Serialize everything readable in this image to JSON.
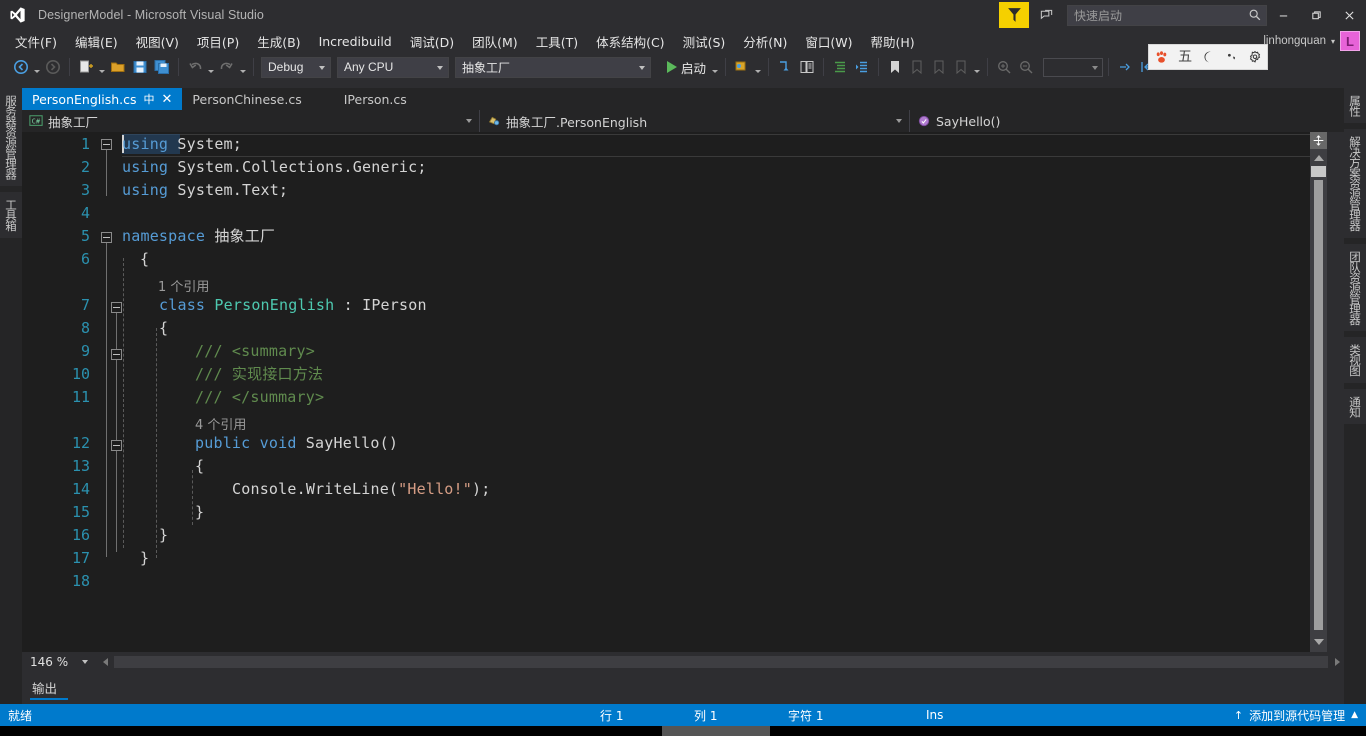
{
  "titlebar": {
    "title": "DesignerModel - Microsoft Visual Studio",
    "quick_launch_placeholder": "快速启动",
    "minimize": "─",
    "maximize": "❐",
    "close": "✕"
  },
  "user": {
    "name": "linhongquan",
    "caret": "▾",
    "avatar_initial": "L",
    "avatar_color": "#e763d8"
  },
  "menubar": {
    "items": [
      {
        "label": "文件(F)"
      },
      {
        "label": "编辑(E)"
      },
      {
        "label": "视图(V)"
      },
      {
        "label": "项目(P)"
      },
      {
        "label": "生成(B)"
      },
      {
        "label": "Incredibuild"
      },
      {
        "label": "调试(D)"
      },
      {
        "label": "团队(M)"
      },
      {
        "label": "工具(T)"
      },
      {
        "label": "体系结构(C)"
      },
      {
        "label": "测试(S)"
      },
      {
        "label": "分析(N)"
      },
      {
        "label": "窗口(W)"
      },
      {
        "label": "帮助(H)"
      }
    ]
  },
  "toolbar": {
    "configuration": "Debug",
    "platform": "Any CPU",
    "startup_project": "抽象工厂",
    "run_label": "启动",
    "find_value": ""
  },
  "ime": {
    "icons": [
      "paw-icon",
      "五",
      "moon-icon",
      "punctuation-icon",
      "gear-icon"
    ]
  },
  "left_dock": {
    "tabs": [
      "服务器资源管理器",
      "工具箱"
    ]
  },
  "right_dock": {
    "tabs": [
      "属性",
      "解决方案资源管理器",
      "团队资源管理器",
      "类视图",
      "通知"
    ]
  },
  "tabs": [
    {
      "label": "PersonEnglish.cs",
      "active": true,
      "pin": "中",
      "close": "✕"
    },
    {
      "label": "PersonChinese.cs",
      "active": false
    },
    {
      "label": "IPerson.cs",
      "active": false
    }
  ],
  "navbar": {
    "project": "抽象工厂",
    "type": "抽象工厂.PersonEnglish",
    "member": "SayHello()"
  },
  "editor": {
    "zoom": "146 %",
    "lines": [
      {
        "num": "1",
        "text": "using System;"
      },
      {
        "num": "2",
        "text": "using System.Collections.Generic;"
      },
      {
        "num": "3",
        "text": "using System.Text;"
      },
      {
        "num": "4",
        "text": ""
      },
      {
        "num": "5",
        "text": "namespace 抽象工厂"
      },
      {
        "num": "6",
        "text": "{"
      },
      {
        "num": "7",
        "text": "    class PersonEnglish : IPerson"
      },
      {
        "num": "8",
        "text": "    {"
      },
      {
        "num": "9",
        "text": "        /// <summary>"
      },
      {
        "num": "10",
        "text": "        /// 实现接口方法"
      },
      {
        "num": "11",
        "text": "        /// </summary>"
      },
      {
        "num": "12",
        "text": "        public void SayHello()"
      },
      {
        "num": "13",
        "text": "        {"
      },
      {
        "num": "14",
        "text": "            Console.WriteLine(\"Hello!\");"
      },
      {
        "num": "15",
        "text": "        }"
      },
      {
        "num": "16",
        "text": "    }"
      },
      {
        "num": "17",
        "text": "}"
      },
      {
        "num": "18",
        "text": ""
      }
    ],
    "codelens": [
      {
        "text": "1 个引用",
        "above_line": "7"
      },
      {
        "text": "4 个引用",
        "above_line": "12"
      }
    ],
    "tokens": {
      "using": "using",
      "system": "System;",
      "system_collections": "System.Collections.Generic;",
      "system_text": "System.Text;",
      "namespace_kw": "namespace",
      "namespace_name": "抽象工厂",
      "brace_open": "{",
      "brace_close": "}",
      "class_kw": "class",
      "class_name": "PersonEnglish",
      "colon": ":",
      "interface_name": "IPerson",
      "doc_summary_open": "/// <summary>",
      "doc_body": "/// 实现接口方法",
      "doc_summary_close": "/// </summary>",
      "public_kw": "public",
      "void_kw": "void",
      "method_name": "SayHello()",
      "console_call": "Console.WriteLine(",
      "string_literal": "\"Hello!\"",
      "call_end": ");"
    },
    "colors": {
      "background": "#1e1e1e",
      "keyword": "#569cd6",
      "type": "#4ec9b0",
      "string": "#d69d85",
      "comment": "#57a64a",
      "doc_comment": "#608b4e",
      "line_number": "#2b91af",
      "text": "#d4d4d4"
    }
  },
  "output_panel": {
    "tab_label": "输出"
  },
  "statusbar": {
    "state": "就绪",
    "line_label": "行",
    "line_value": "1",
    "col_label": "列",
    "col_value": "1",
    "char_label": "字符",
    "char_value": "1",
    "insert_mode": "Ins",
    "source_control": "添加到源代码管理",
    "source_control_arrow": "↑",
    "source_control_caret": "▲",
    "accent_color": "#007acc"
  }
}
